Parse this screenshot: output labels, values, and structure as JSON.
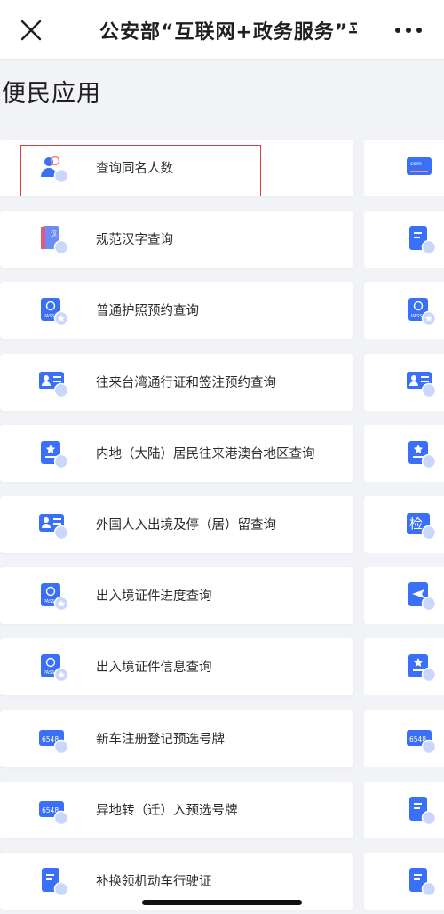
{
  "header": {
    "title": "公安部“互联网+政务服务”平"
  },
  "section": {
    "title": "便民应用"
  },
  "services": [
    {
      "label": "查询同名人数",
      "icon": "people-search-icon",
      "right_icon": "com-card-icon"
    },
    {
      "label": "规范汉字查询",
      "icon": "dictionary-book-icon",
      "right_icon": "document-icon"
    },
    {
      "label": "普通护照预约查询",
      "icon": "passport-icon",
      "right_icon": "passport-icon"
    },
    {
      "label": "往来台湾通行证和签注预约查询",
      "icon": "id-card-icon",
      "right_icon": "id-card-icon"
    },
    {
      "label": "内地（大陆）居民往来港澳台地区查询",
      "icon": "passport-star-icon",
      "right_icon": "passport-star-icon"
    },
    {
      "label": "外国人入出境及停（居）留查询",
      "icon": "id-card-icon",
      "right_icon": "inspection-icon"
    },
    {
      "label": "出入境证件进度查询",
      "icon": "passport-icon",
      "right_icon": "flight-icon"
    },
    {
      "label": "出入境证件信息查询",
      "icon": "passport-icon",
      "right_icon": "passport-star-icon"
    },
    {
      "label": "新车注册登记预选号牌",
      "icon": "license-plate-icon",
      "right_icon": "license-plate-icon"
    },
    {
      "label": "异地转（迁）入预选号牌",
      "icon": "license-plate-icon",
      "right_icon": "document-icon"
    },
    {
      "label": "补换领机动车行驶证",
      "icon": "document-icon",
      "right_icon": "document-icon"
    }
  ],
  "plate_text": "6548",
  "passport_text": "PASS",
  "com_text": "com",
  "inspect_text": "检",
  "dict_text": "汉",
  "colors": {
    "accent": "#3a6ff7",
    "accent_light": "#9fbaf9",
    "highlight": "#e23b3b"
  }
}
